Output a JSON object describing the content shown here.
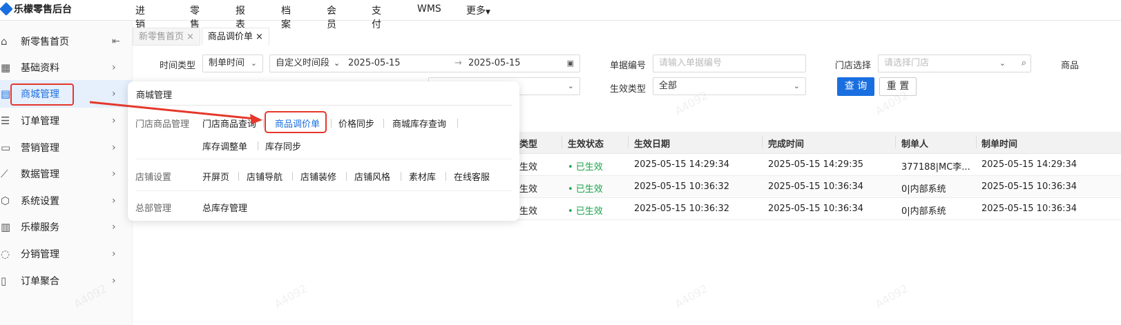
{
  "app": {
    "title": "乐檬零售后台"
  },
  "topnav": [
    "进销存",
    "零售",
    "报表",
    "档案",
    "会员",
    "支付",
    "WMS",
    "更多"
  ],
  "sidebar": {
    "items": [
      {
        "label": "新零售首页",
        "icon": "home-icon"
      },
      {
        "label": "基础资料",
        "icon": "grid-icon"
      },
      {
        "label": "商城管理",
        "icon": "store-icon"
      },
      {
        "label": "订单管理",
        "icon": "order-icon"
      },
      {
        "label": "营销管理",
        "icon": "marketing-icon"
      },
      {
        "label": "数据管理",
        "icon": "chart-icon"
      },
      {
        "label": "系统设置",
        "icon": "settings-icon"
      },
      {
        "label": "乐檬服务",
        "icon": "building-icon"
      },
      {
        "label": "分销管理",
        "icon": "share-icon"
      },
      {
        "label": "订单聚合",
        "icon": "doc-icon"
      }
    ]
  },
  "tabs": [
    {
      "label": "新零售首页",
      "close": "×"
    },
    {
      "label": "商品调价单",
      "close": "×"
    }
  ],
  "filters": {
    "time_type_label": "时间类型",
    "time_type_value": "制单时间",
    "period_value": "自定义时间段",
    "date_start": "2025-05-15",
    "date_arrow": "→",
    "date_end": "2025-05-15",
    "doc_no_label": "单据编号",
    "doc_no_placeholder": "请输入单据编号",
    "store_label": "门店选择",
    "store_placeholder": "请选择门店",
    "product_label": "商品",
    "effect_type_label": "生效类型",
    "effect_type_value": "全部",
    "query_button": "查 询",
    "reset_button": "重 置"
  },
  "table": {
    "headers": [
      "类型",
      "生效状态",
      "生效日期",
      "完成时间",
      "制单人",
      "制单时间"
    ],
    "rows": [
      [
        "生效",
        "• 已生效",
        "2025-05-15 14:29:34",
        "2025-05-15 14:29:35",
        "377188|MC李...",
        "2025-05-15 14:29:34"
      ],
      [
        "生效",
        "• 已生效",
        "2025-05-15 10:36:32",
        "2025-05-15 10:36:34",
        "0|内部系统",
        "2025-05-15 10:36:34"
      ],
      [
        "生效",
        "• 已生效",
        "2025-05-15 10:36:32",
        "2025-05-15 10:36:34",
        "0|内部系统",
        "2025-05-15 10:36:34"
      ]
    ]
  },
  "menu_panel": {
    "title": "商城管理",
    "groups": [
      {
        "name": "门店商品管理",
        "items": [
          "门店商品查询",
          "商品调价单",
          "价格同步",
          "商城库存查询",
          "库存调整单",
          "库存同步"
        ]
      },
      {
        "name": "店铺设置",
        "items": [
          "开屏页",
          "店铺导航",
          "店铺装修",
          "店铺风格",
          "素材库",
          "在线客服"
        ]
      },
      {
        "name": "总部管理",
        "items": [
          "总库存管理"
        ]
      }
    ]
  },
  "watermark": "A4092",
  "colors": {
    "accent": "#1a6fe0",
    "annotation_red": "#e5372a",
    "status_green": "#1aa34a"
  }
}
